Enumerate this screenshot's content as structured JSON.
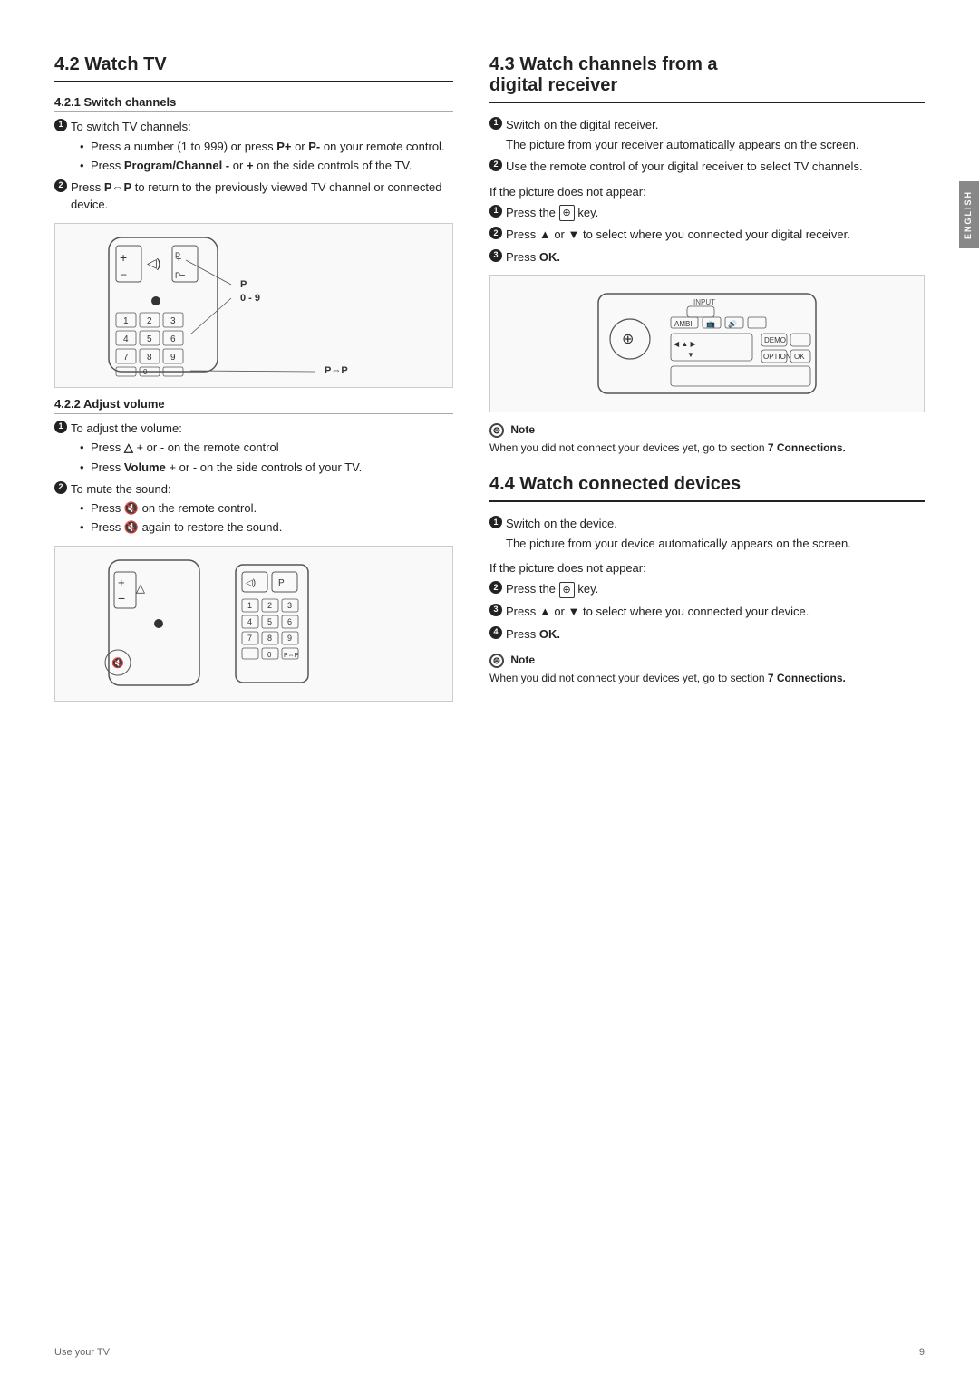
{
  "page": {
    "footer_left": "Use your TV",
    "footer_right": "9",
    "side_tab": "ENGLISH"
  },
  "section42": {
    "title": "4.2   Watch TV",
    "sub421": {
      "heading": "4.2.1   Switch channels",
      "steps": [
        {
          "num": "1",
          "text": "To switch TV channels:"
        },
        {
          "num": "2",
          "text": "Press P⇔P to return to the previously viewed TV channel or connected device."
        }
      ],
      "bullets_421": [
        "Press a number (1 to 999) or press P+ or P- on your remote control.",
        "Press Program/Channel - or + on the side controls of the TV."
      ]
    },
    "sub422": {
      "heading": "4.2.2   Adjust volume",
      "steps": [
        {
          "num": "1",
          "text": "To adjust the volume:"
        },
        {
          "num": "2",
          "text": "To mute the sound:"
        }
      ],
      "bullets_vol": [
        "Press △ + or - on the remote control",
        "Press Volume + or - on the side controls of your TV."
      ],
      "bullets_mute": [
        "Press 🔇 on the remote control.",
        "Press 🔇 again to restore the sound."
      ]
    }
  },
  "section43": {
    "title": "4.3   Watch channels from a digital receiver",
    "steps": [
      {
        "num": "1",
        "text": "Switch on the digital receiver."
      },
      {
        "num": "2",
        "text": "Use the remote control of your digital receiver to select TV channels."
      }
    ],
    "subtext1": "The picture from your receiver automatically appears on the screen.",
    "if_no_picture": "If the picture does not appear:",
    "sub_steps": [
      {
        "num": "1",
        "text": "Press the ⌁ key."
      },
      {
        "num": "2",
        "text": "Press ▲ or ▼ to select where you connected your digital receiver."
      },
      {
        "num": "3",
        "text": "Press OK."
      }
    ],
    "note_title": "Note",
    "note_text": "When you did not connect your devices yet, go to section 7 Connections."
  },
  "section44": {
    "title": "4.4   Watch connected devices",
    "steps": [
      {
        "num": "1",
        "text": "Switch on the device."
      }
    ],
    "subtext1": "The picture from your device automatically appears on the screen.",
    "if_no_picture": "If the picture does not appear:",
    "sub_steps": [
      {
        "num": "2",
        "text": "Press the ⌁ key."
      },
      {
        "num": "3",
        "text": "Press ▲ or ▼ to select where you connected your device."
      },
      {
        "num": "4",
        "text": "Press OK."
      }
    ],
    "note_title": "Note",
    "note_text": "When you did not connect your devices yet, go to section 7 Connections."
  }
}
